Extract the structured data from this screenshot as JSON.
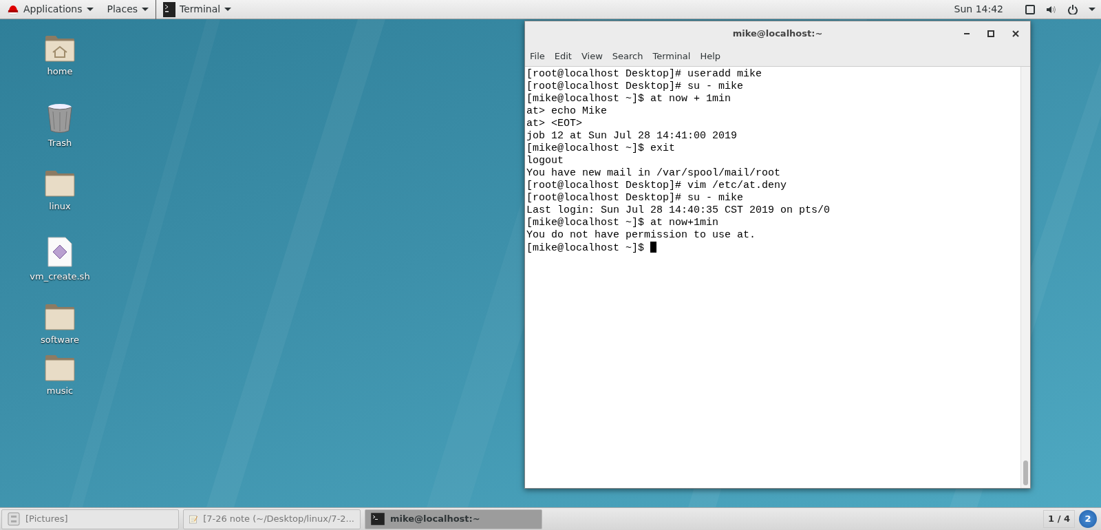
{
  "top_bar": {
    "menus": [
      {
        "label": "Applications",
        "kind": "apps"
      },
      {
        "label": "Places",
        "kind": "plain"
      },
      {
        "label": "Terminal",
        "kind": "app"
      }
    ],
    "clock": "Sun 14:42"
  },
  "desktop_icons": [
    {
      "label": "home",
      "kind": "home"
    },
    {
      "label": "Trash",
      "kind": "trash"
    },
    {
      "label": "linux",
      "kind": "folder"
    },
    {
      "label": "vm_create.sh",
      "kind": "script"
    },
    {
      "label": "software",
      "kind": "folder"
    },
    {
      "label": "music",
      "kind": "folder"
    }
  ],
  "terminal": {
    "title": "mike@localhost:~",
    "menu": [
      "File",
      "Edit",
      "View",
      "Search",
      "Terminal",
      "Help"
    ],
    "lines": [
      "[root@localhost Desktop]# useradd mike",
      "[root@localhost Desktop]# su - mike",
      "[mike@localhost ~]$ at now + 1min",
      "at> echo Mike",
      "at> <EOT>",
      "job 12 at Sun Jul 28 14:41:00 2019",
      "[mike@localhost ~]$ exit",
      "logout",
      "You have new mail in /var/spool/mail/root",
      "[root@localhost Desktop]# vim /etc/at.deny",
      "[root@localhost Desktop]# su - mike",
      "Last login: Sun Jul 28 14:40:35 CST 2019 on pts/0",
      "[mike@localhost ~]$ at now+1min",
      "You do not have permission to use at.",
      "[mike@localhost ~]$ "
    ]
  },
  "taskbar": {
    "items": [
      {
        "label": "[Pictures]",
        "kind": "files",
        "selected": false
      },
      {
        "label": "[7-26 note (~/Desktop/linux/7-2...",
        "kind": "editor",
        "selected": false
      },
      {
        "label": "mike@localhost:~",
        "kind": "terminal",
        "selected": true
      }
    ],
    "workspace": "1 / 4",
    "notifications": "2"
  }
}
